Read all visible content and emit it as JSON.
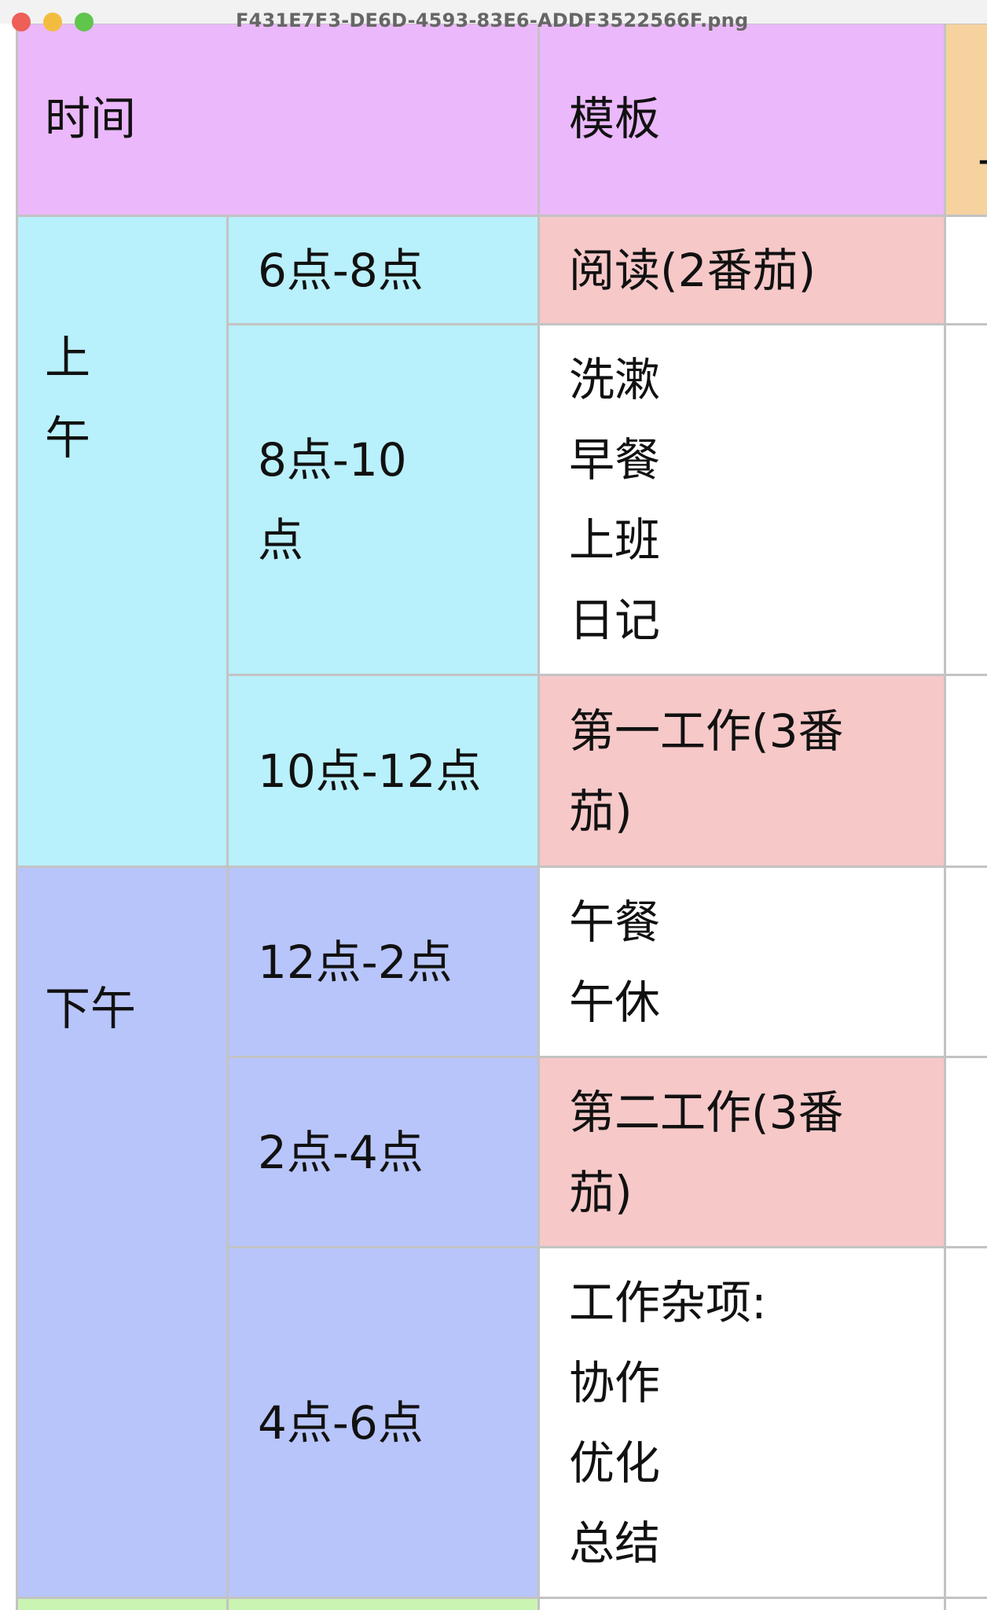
{
  "window": {
    "title": "F431E7F3-DE6D-4593-83E6-ADDF3522566F.png"
  },
  "table": {
    "headers": {
      "time": "时间",
      "template": "模板",
      "partial": "\n-"
    },
    "groups": [
      {
        "label": "上\n午",
        "rows": [
          {
            "time": "6点-8点",
            "template": "阅读(2番茄)"
          },
          {
            "time": "8点-10\n点",
            "template": "洗漱\n早餐\n上班\n日记"
          },
          {
            "time": "10点-12点",
            "template": "第一工作(3番\n茄)"
          }
        ]
      },
      {
        "label": "下午",
        "rows": [
          {
            "time": "12点-2点",
            "template": "午餐\n午休"
          },
          {
            "time": "2点-4点",
            "template": "第二工作(3番\n茄)"
          },
          {
            "time": "4点-6点",
            "template": "工作杂项:\n协作\n优化\n总结"
          }
        ]
      }
    ]
  },
  "colors": {
    "header": "#ebb8fb",
    "partial_header": "#f6d29f",
    "morning": "#b8f0fb",
    "afternoon": "#b8c5fb",
    "focus_block": "#f6c8c8",
    "next_section": "#c9f4b1"
  }
}
